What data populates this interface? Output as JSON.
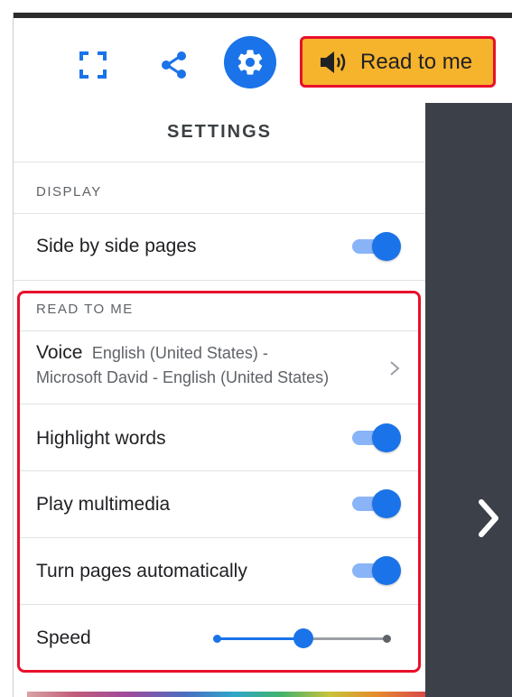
{
  "toolbar": {
    "fullscreen_icon": "fullscreen-icon",
    "share_icon": "share-icon",
    "settings_icon": "gear-icon",
    "read_to_me_label": "Read to me",
    "read_to_me_icon": "speaker-icon"
  },
  "panel": {
    "title": "SETTINGS",
    "display": {
      "section_label": "DISPLAY",
      "side_by_side_label": "Side by side pages",
      "side_by_side_on": true
    },
    "read_to_me": {
      "section_label": "READ TO ME",
      "voice_label": "Voice",
      "voice_value_line1": "English (United States) -",
      "voice_value_line2": "Microsoft David - English (United States)",
      "highlight_words_label": "Highlight words",
      "highlight_words_on": true,
      "play_multimedia_label": "Play multimedia",
      "play_multimedia_on": true,
      "turn_pages_label": "Turn pages automatically",
      "turn_pages_on": true,
      "speed_label": "Speed",
      "speed_fraction": 0.5
    }
  },
  "colors": {
    "accent": "#1a73e8",
    "read_button": "#f6b32c",
    "highlight_outline": "#e8102c",
    "dark_pane": "#3c4048"
  }
}
